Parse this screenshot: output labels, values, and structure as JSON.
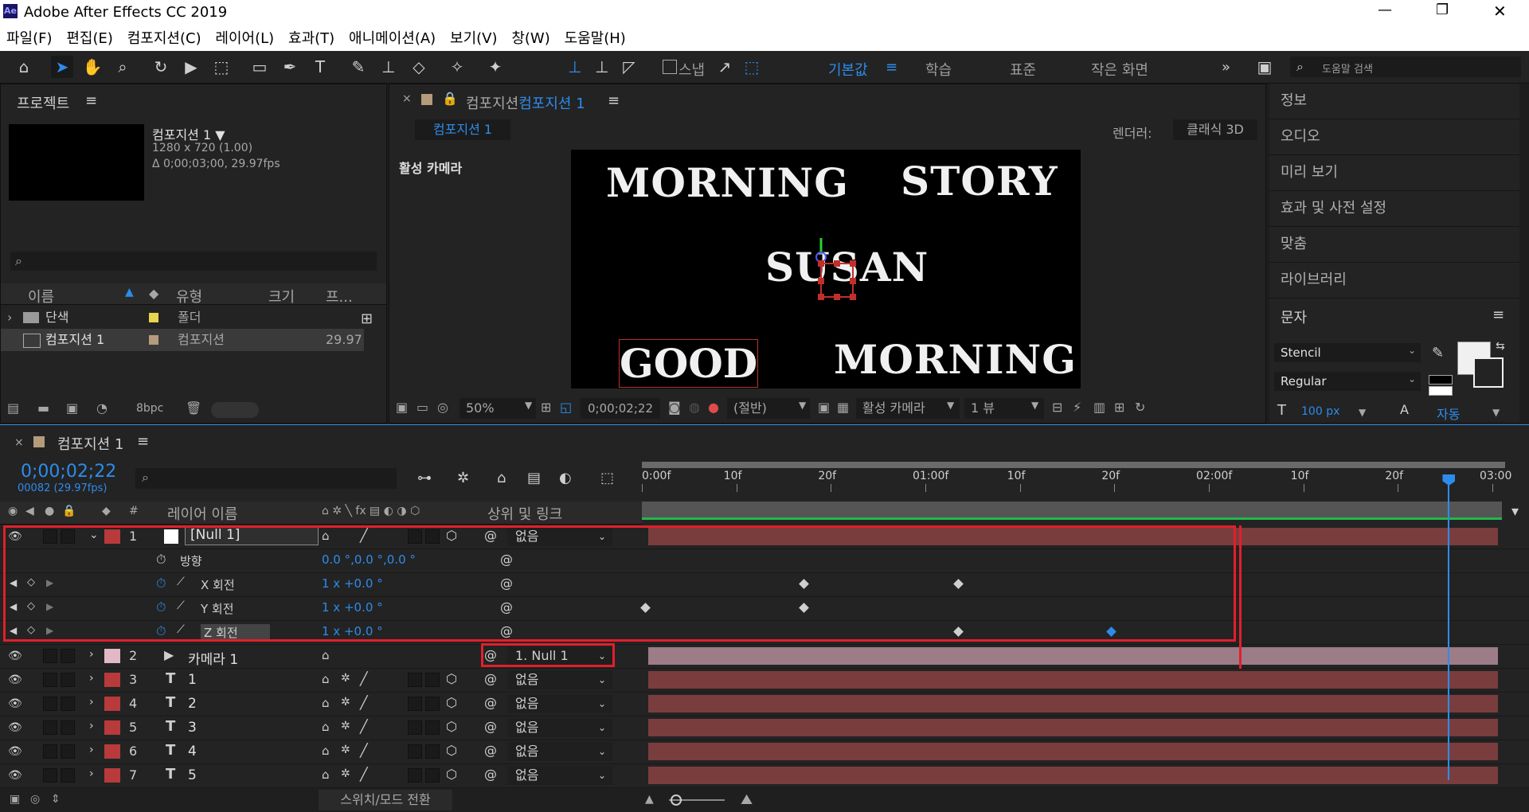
{
  "app": {
    "title": "Adobe After Effects CC 2019",
    "logo": "Ae",
    "window_buttons": [
      "—",
      "❐",
      "✕"
    ]
  },
  "menu": [
    "파일(F)",
    "편집(E)",
    "컴포지션(C)",
    "레이어(L)",
    "효과(T)",
    "애니메이션(A)",
    "보기(V)",
    "창(W)",
    "도움말(H)"
  ],
  "toolbar": {
    "snap_label": "스냅",
    "workspaces": [
      "기본값",
      "학습",
      "표준",
      "작은 화면"
    ],
    "search_placeholder": "도움말 검색"
  },
  "project": {
    "title": "프로젝트",
    "comp_name": "컴포지션 1 ▼",
    "comp_info1": "1280 x 720 (1.00)",
    "comp_info2": "Δ 0;00;03;00, 29.97fps",
    "columns": [
      "이름",
      "유형",
      "크기",
      "프..."
    ],
    "items": [
      {
        "name": "단색",
        "type": "폴더",
        "fps": "",
        "color": "#e8d44d"
      },
      {
        "name": "컴포지션 1",
        "type": "컴포지션",
        "fps": "29.97",
        "color": "#b49b7c"
      }
    ],
    "bpc": "8bpc"
  },
  "viewer": {
    "tab_title": "컴포지션",
    "tab_title_blue": "컴포지션 1",
    "crumb": "컴포지션 1",
    "renderer_label": "렌더러:",
    "renderer_value": "클래식 3D",
    "active_camera": "활성 카메라",
    "canvas_words": [
      "MORNING",
      "STORY",
      "SUSAN",
      "GOOD",
      "MORNING"
    ],
    "zoom": "50%",
    "timecode": "0;00;02;22",
    "resolution": "(절반)",
    "camera_select": "활성 카메라",
    "views": "1 뷰"
  },
  "right_panel": {
    "items": [
      "정보",
      "오디오",
      "미리 보기",
      "효과 및 사전 설정",
      "맞춤",
      "라이브러리"
    ],
    "character_title": "문자",
    "font": "Stencil",
    "style": "Regular",
    "size": "100",
    "size_unit": "px",
    "leading": "자동"
  },
  "timeline": {
    "tab": "컴포지션 1",
    "timecode": "0;00;02;22",
    "frame_info": "00082 (29.97fps)",
    "col_layer_name": "레이어 이름",
    "col_parent": "상위 및 링크",
    "ruler": [
      "0:00f",
      "10f",
      "20f",
      "01:00f",
      "10f",
      "20f",
      "02:00f",
      "10f",
      "20f",
      "03:00"
    ],
    "current_time_fraction": 0.948,
    "layers": [
      {
        "num": "1",
        "name": "[Null 1]",
        "parent": "없음",
        "color": "#b83a3a",
        "type": "null"
      },
      {
        "num": "2",
        "name": "카메라 1",
        "parent": "1. Null 1",
        "color": "#e2b8c6",
        "type": "camera"
      },
      {
        "num": "3",
        "name": "1",
        "parent": "없음",
        "color": "#b83a3a",
        "type": "text"
      },
      {
        "num": "4",
        "name": "2",
        "parent": "없음",
        "color": "#b83a3a",
        "type": "text"
      },
      {
        "num": "5",
        "name": "3",
        "parent": "없음",
        "color": "#b83a3a",
        "type": "text"
      },
      {
        "num": "6",
        "name": "4",
        "parent": "없음",
        "color": "#b83a3a",
        "type": "text"
      },
      {
        "num": "7",
        "name": "5",
        "parent": "없음",
        "color": "#b83a3a",
        "type": "text"
      }
    ],
    "properties": [
      {
        "name": "방향",
        "value": "0.0 °,0.0 °,0.0 °"
      },
      {
        "name": "X 회전",
        "value": "1 x +0.0 °"
      },
      {
        "name": "Y 회전",
        "value": "1 x +0.0 °"
      },
      {
        "name": "Z 회전",
        "value": "1 x +0.0 °"
      }
    ],
    "switch_mode": "스위치/모드 전환"
  },
  "colors": {
    "accent": "#2d8ceb",
    "highlight": "#e0202a",
    "layer_bar": "#7a3d3d",
    "camera_bar": "#9c7c86"
  }
}
